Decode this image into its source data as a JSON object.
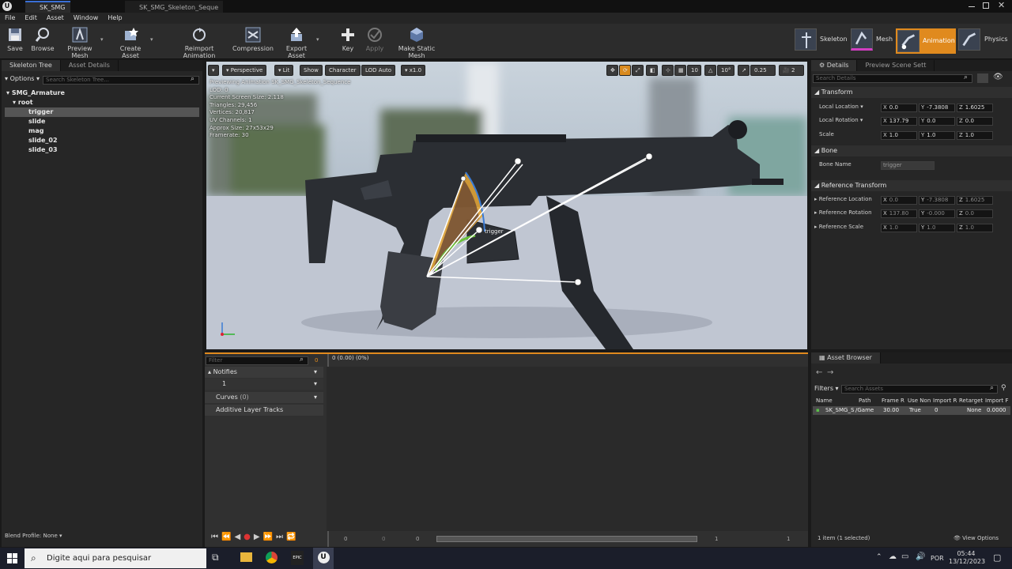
{
  "window": {
    "tab1": "SK_SMG",
    "tab2": "SK_SMG_Skeleton_Seque"
  },
  "menu": [
    "File",
    "Edit",
    "Asset",
    "Window",
    "Help"
  ],
  "toolbar": {
    "save": "Save",
    "browse": "Browse",
    "preview_mesh": "Preview Mesh",
    "create_asset": "Create Asset",
    "reimport": "Reimport Animation",
    "compression": "Compression",
    "export": "Export Asset",
    "key": "Key",
    "apply": "Apply",
    "make_static": "Make Static Mesh"
  },
  "modes": {
    "skeleton": "Skeleton",
    "mesh": "Mesh",
    "animation": "Animation",
    "physics": "Physics",
    "active_color": "#e08a1e"
  },
  "left_panel": {
    "tab_tree": "Skeleton Tree",
    "tab_details": "Asset Details",
    "options": "Options",
    "search_placeholder": "Search Skeleton Tree...",
    "bones": [
      "SMG_Armature",
      "root",
      "trigger",
      "slide",
      "mag",
      "slide_02",
      "slide_03"
    ],
    "blend_profile": "Blend Profile: None"
  },
  "viewport": {
    "perspective": "Perspective",
    "lit": "Lit",
    "show": "Show",
    "character": "Character",
    "lod": "LOD Auto",
    "speed": "x1.0",
    "snap_grid": "10",
    "snap_angle": "10°",
    "snap_scale": "0.25",
    "cam_speed": "2",
    "stats": [
      "Previewing Animation SK_SMG_Skeleton_Sequence",
      "LOD: 0",
      "Current Screen Size: 2.118",
      "Triangles: 29,456",
      "Vertices: 20,817",
      "UV Channels: 1",
      "Approx Size: 27x53x29",
      "Framerate: 30"
    ],
    "bone_label": "trigger"
  },
  "timeline": {
    "filter_placeholder": "Filter",
    "frame": "0",
    "time": "0 (0.00) (0%)",
    "notifies": "Notifies",
    "notify_track": "1",
    "curves": "Curves",
    "curves_count": "(0)",
    "additive": "Additive Layer Tracks",
    "start": "0",
    "start2": "0",
    "current": "0",
    "end": "1",
    "end2": "1"
  },
  "details": {
    "tab_details": "Details",
    "tab_preview": "Preview Scene Sett",
    "search_placeholder": "Search Details",
    "transform": "Transform",
    "local_location": "Local Location",
    "local_rotation": "Local Rotation",
    "scale": "Scale",
    "loc": [
      "0.0",
      "-7.3808",
      "1.6025"
    ],
    "rot": [
      "137.79",
      "0.0",
      "0.0"
    ],
    "scl": [
      "1.0",
      "1.0",
      "1.0"
    ],
    "bone_section": "Bone",
    "bone_name_label": "Bone Name",
    "bone_name": "trigger",
    "ref_section": "Reference Transform",
    "ref_location": "Reference Location",
    "ref_rotation": "Reference Rotation",
    "ref_scale": "Reference Scale",
    "ref_loc": [
      "0.0",
      "-7.3808",
      "1.6025"
    ],
    "ref_rot": [
      "137.80",
      "-0.000",
      "0.0"
    ],
    "ref_scl": [
      "1.0",
      "1.0",
      "1.0"
    ]
  },
  "asset_browser": {
    "title": "Asset Browser",
    "filters": "Filters",
    "search_placeholder": "Search Assets",
    "columns": [
      "Name",
      "Path",
      "Frame R",
      "Use Non",
      "Import R",
      "Retarget",
      "Import F"
    ],
    "row": [
      "SK_SMG_S",
      "/Game",
      "30.00",
      "True",
      "0",
      "None",
      "0.0000"
    ],
    "status": "1 item (1 selected)",
    "view_options": "View Options"
  },
  "taskbar": {
    "search": "Digite aqui para pesquisar",
    "lang": "POR",
    "time": "05:44",
    "date": "13/12/2023"
  }
}
